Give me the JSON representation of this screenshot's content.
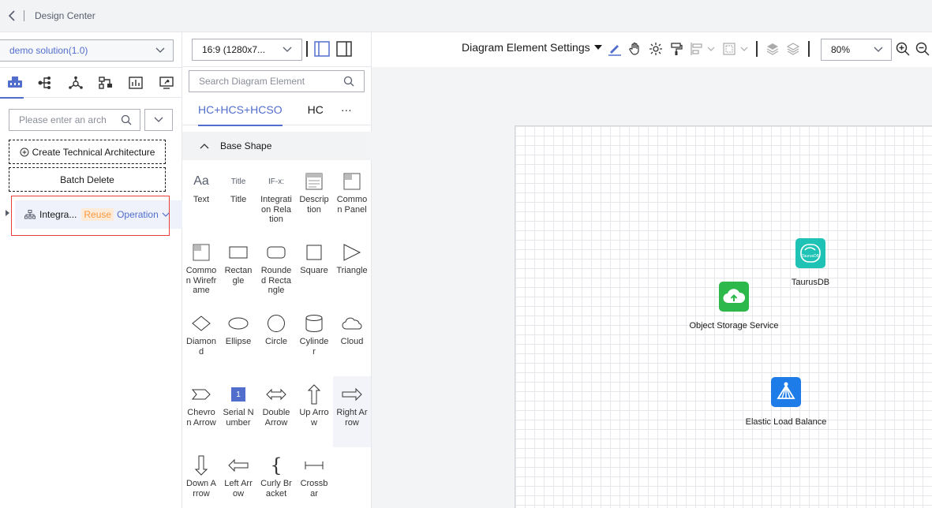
{
  "topbar": {
    "title": "Design Center"
  },
  "left": {
    "solution": "demo solution(1.0)",
    "search_placeholder": "Please enter an arch",
    "create_btn": "Create Technical Architecture",
    "batch_delete": "Batch Delete",
    "tree_item": {
      "label": "Integra...",
      "tag": "Reuse",
      "action": "Operation"
    }
  },
  "middle": {
    "ratio": "16:9 (1280x7...",
    "search_placeholder": "Search Diagram Element",
    "tabs": [
      "HC+HCS+HCSO",
      "HC",
      "···"
    ],
    "section": "Base Shape",
    "shapes": [
      {
        "label": "Text",
        "icon": "text-icon"
      },
      {
        "label": "Title",
        "icon": "title-icon",
        "glyph": "Title"
      },
      {
        "label": "Integration Relation",
        "icon": "integration-relation-icon",
        "glyph": "IF-x:"
      },
      {
        "label": "Description",
        "icon": "description-icon"
      },
      {
        "label": "Common Panel",
        "icon": "common-panel-icon"
      },
      {
        "label": "Common Wireframe",
        "icon": "common-wireframe-icon"
      },
      {
        "label": "Rectangle",
        "icon": "rectangle-icon"
      },
      {
        "label": "Rounded Rectangle",
        "icon": "rounded-rectangle-icon"
      },
      {
        "label": "Square",
        "icon": "square-icon"
      },
      {
        "label": "Triangle",
        "icon": "triangle-icon"
      },
      {
        "label": "Diamond",
        "icon": "diamond-icon"
      },
      {
        "label": "Ellipse",
        "icon": "ellipse-icon"
      },
      {
        "label": "Circle",
        "icon": "circle-icon"
      },
      {
        "label": "Cylinder",
        "icon": "cylinder-icon"
      },
      {
        "label": "Cloud",
        "icon": "cloud-icon"
      },
      {
        "label": "Chevron Arrow",
        "icon": "chevron-arrow-icon"
      },
      {
        "label": "Serial Number",
        "icon": "serial-number-icon",
        "glyph": "1"
      },
      {
        "label": "Double Arrow",
        "icon": "double-arrow-icon"
      },
      {
        "label": "Up Arrow",
        "icon": "up-arrow-icon"
      },
      {
        "label": "Right Arrow",
        "icon": "right-arrow-icon"
      },
      {
        "label": "Down Arrow",
        "icon": "down-arrow-icon"
      },
      {
        "label": "Left Arrow",
        "icon": "left-arrow-icon"
      },
      {
        "label": "Curly Bracket",
        "icon": "curly-bracket-icon"
      },
      {
        "label": "Crossbar",
        "icon": "crossbar-icon"
      }
    ]
  },
  "toolbar": {
    "settings": "Diagram Element Settings",
    "zoom": "80%"
  },
  "canvas": {
    "nodes": [
      {
        "label": "TaurusDB",
        "icon": "taurusdb-icon",
        "color": "#1fc3b5",
        "glyph": "TaurusDB"
      },
      {
        "label": "Object Storage Service",
        "icon": "object-storage-icon",
        "color": "#2cb84b"
      },
      {
        "label": "Elastic Load Balance",
        "icon": "load-balance-icon",
        "color": "#1e7ce8"
      }
    ]
  },
  "colors": {
    "accent": "#526ecc",
    "highlight_border": "#e8403a",
    "reuse_tag": "#fa9841"
  }
}
